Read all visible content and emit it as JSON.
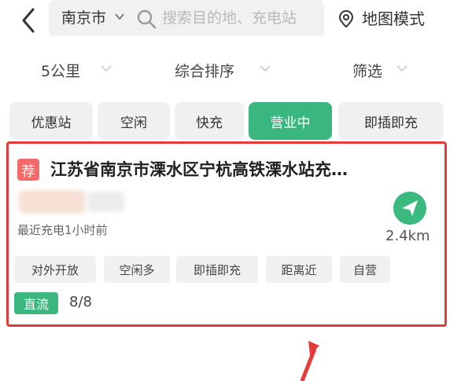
{
  "header": {
    "city": "南京市",
    "search_placeholder": "搜索目的地、充电站",
    "map_mode": "地图模式"
  },
  "filters": [
    "5公里",
    "综合排序",
    "筛选"
  ],
  "chips": [
    {
      "label": "优惠站",
      "active": false
    },
    {
      "label": "空闲",
      "active": false
    },
    {
      "label": "快充",
      "active": false
    },
    {
      "label": "营业中",
      "active": true
    },
    {
      "label": "即插即充",
      "active": false
    }
  ],
  "station": {
    "badge": "荐",
    "name": "江苏省南京市溧水区宁杭高铁溧水站充…",
    "last_charge": "最近充电1小时前",
    "distance": "2.4km",
    "tags": [
      "对外开放",
      "空闲多",
      "即插即充",
      "距离近",
      "自营"
    ],
    "power_type": "直流",
    "slots": "8/8"
  },
  "colors": {
    "accent_green": "#3ab77e",
    "highlight_red": "#e53a3a",
    "recommend_badge": "#f36a6a"
  },
  "icons": [
    "back-chevron-icon",
    "chevron-down-icon",
    "search-icon",
    "map-pin-icon",
    "navigate-arrow-icon"
  ]
}
